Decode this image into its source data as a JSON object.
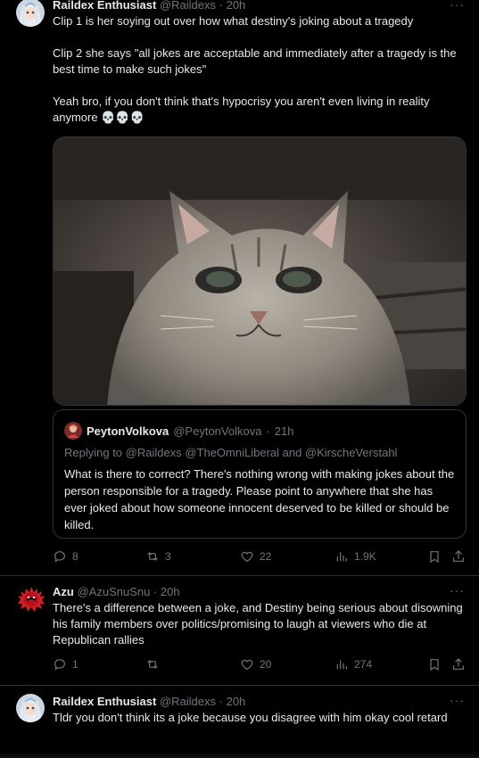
{
  "tweets": [
    {
      "author": "Raildex Enthusiast",
      "handle": "@Raildexs",
      "sep": "·",
      "time": "20h",
      "lines": [
        "Clip 1 is her soying out over how what destiny's joking about a tragedy",
        "Clip 2 she says \"all jokes are acceptable and immediately after a tragedy is the best time to make such jokes\"",
        "Yeah bro, if you don't think that's hypocrisy you aren't even living in reality anymore 💀💀💀"
      ],
      "quote": {
        "author": "PeytonVolkova",
        "handle": "@PeytonVolkova",
        "sep": "·",
        "time": "21h",
        "replying_prefix": "Replying to",
        "replying_to": "@Raildexs @TheOmniLiberal and @KirscheVerstahl",
        "text": "What is there to correct? There's nothing wrong with making jokes about the person responsible for a tragedy. Please point to anywhere that she has ever joked about how someone innocent deserved to be killed or should be killed."
      },
      "stats": {
        "replies": "8",
        "reposts": "3",
        "likes": "22",
        "views": "1.9K"
      }
    },
    {
      "author": "Azu",
      "handle": "@AzuSnuSnu",
      "sep": "·",
      "time": "20h",
      "text": "There's a difference between a joke, and Destiny being serious about disowning his family members over politics/promising to laugh at viewers who die at Republican rallies",
      "stats": {
        "replies": "1",
        "reposts": "",
        "likes": "20",
        "views": "274"
      }
    },
    {
      "author": "Raildex Enthusiast",
      "handle": "@Raildexs",
      "sep": "·",
      "time": "20h",
      "text": "Tldr you don't think its a joke because you disagree with him okay cool retard"
    }
  ],
  "more_label": "···",
  "colors": {
    "bg": "#000000",
    "text": "#e7e9ea",
    "muted": "#71767b",
    "border": "#2f3336"
  }
}
